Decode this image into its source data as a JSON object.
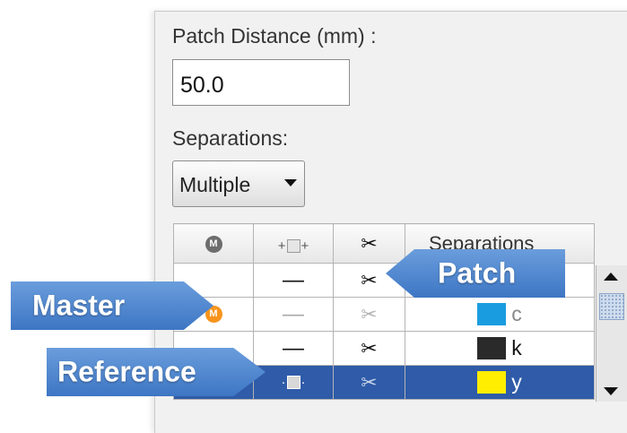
{
  "panel": {
    "patch_distance_label": "Patch Distance (mm) :",
    "patch_distance_value": "50.0",
    "separations_label": "Separations:",
    "separations_mode": "Multiple"
  },
  "table": {
    "columns": [
      {
        "icon": "master-icon",
        "text": "M"
      },
      {
        "icon": "patch-control-icon",
        "text": "+□+"
      },
      {
        "icon": "scissors-icon",
        "text": "✂"
      },
      {
        "label": "Separations"
      }
    ],
    "rows": [
      {
        "master": "",
        "patch": "—",
        "cut": "✂",
        "label": "",
        "color": "",
        "state": "normal"
      },
      {
        "master": "M",
        "patch": "—",
        "cut": "✂",
        "label": "c",
        "color": "#1a9de0",
        "state": "dim"
      },
      {
        "master": "",
        "patch": "—",
        "cut": "✂",
        "label": "k",
        "color": "#2a2a2a",
        "state": "normal"
      },
      {
        "master": "",
        "patch": "+□+",
        "cut": "✂",
        "label": "y",
        "color": "#ffee00",
        "state": "selected"
      }
    ]
  },
  "annotations": {
    "master": "Master",
    "reference": "Reference",
    "patch": "Patch"
  },
  "colors": {
    "callout": "#4a84cf",
    "selection": "#2f5ba8",
    "master_badge": "#f7941d",
    "cyan": "#1a9de0",
    "black": "#2a2a2a",
    "yellow": "#ffee00"
  }
}
